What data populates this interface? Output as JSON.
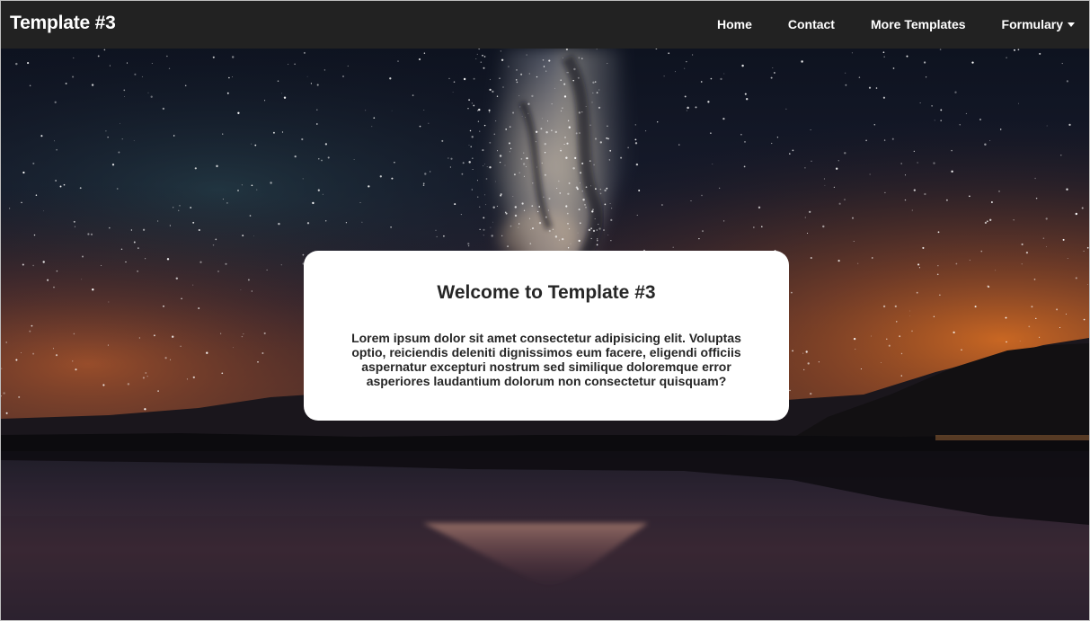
{
  "brand": "Template #3",
  "nav": {
    "home": "Home",
    "contact": "Contact",
    "more_templates": "More Templates",
    "formulary": "Formulary"
  },
  "hero": {
    "title": "Welcome to Template #3",
    "text": "Lorem ipsum dolor sit amet consectetur adipisicing elit. Voluptas optio, reiciendis deleniti dignissimos eum facere, eligendi officiis aspernatur excepturi nostrum sed similique doloremque error asperiores laudantium dolorum non consectetur quisquam?"
  },
  "colors": {
    "navbar_bg": "#222222",
    "nav_text": "#ffffff",
    "card_bg": "#ffffff",
    "card_text": "#262626"
  },
  "icons": {
    "dropdown": "caret-down-icon"
  }
}
